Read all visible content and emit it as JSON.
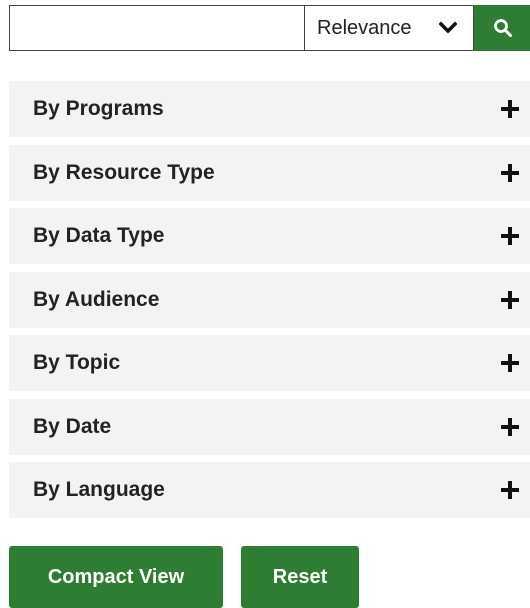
{
  "search": {
    "input_value": "",
    "input_placeholder": "",
    "sort_value": "Relevance",
    "search_icon": "search-icon"
  },
  "facets": [
    {
      "label": "By Programs",
      "icon": "plus-icon"
    },
    {
      "label": "By Resource Type",
      "icon": "plus-icon"
    },
    {
      "label": "By Data Type",
      "icon": "plus-icon"
    },
    {
      "label": "By Audience",
      "icon": "plus-icon"
    },
    {
      "label": "By Topic",
      "icon": "plus-icon"
    },
    {
      "label": "By Date",
      "icon": "plus-icon"
    },
    {
      "label": "By Language",
      "icon": "plus-icon"
    }
  ],
  "actions": {
    "compact_view_label": "Compact View",
    "reset_label": "Reset"
  },
  "colors": {
    "accent": "#2e7d32",
    "facet_background": "#f3f3f3",
    "text": "#222222"
  }
}
